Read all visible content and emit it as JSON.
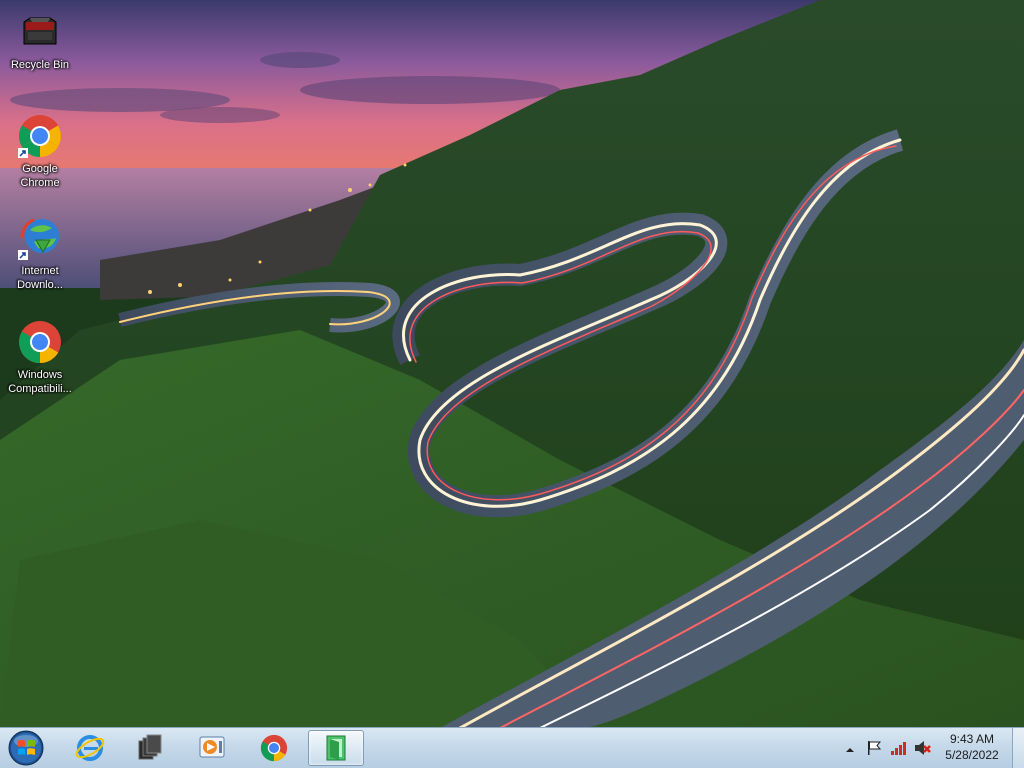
{
  "desktop": {
    "icons": [
      {
        "label": "Recycle Bin",
        "icon": "recycle-bin-icon"
      },
      {
        "label": "Google Chrome",
        "icon": "chrome-icon"
      },
      {
        "label": "Internet Downlo...",
        "icon": "internet-download-manager-icon"
      },
      {
        "label": "Windows Compatibili...",
        "icon": "chrome-icon"
      }
    ]
  },
  "taskbar": {
    "start": {
      "icon": "windows-start-orb-icon"
    },
    "pinned": [
      {
        "icon": "internet-explorer-icon"
      },
      {
        "icon": "window-switcher-icon"
      },
      {
        "icon": "media-player-icon"
      },
      {
        "icon": "chrome-icon"
      },
      {
        "icon": "file-explorer-window-icon",
        "active": true
      }
    ],
    "tray": {
      "icons": [
        "show-hidden-icons-chevron",
        "action-center-flag-icon",
        "network-disconnected-icon",
        "volume-muted-icon"
      ],
      "time": "9:43 AM",
      "date": "5/28/2022"
    }
  },
  "colors": {
    "taskbar_top": "#dbe8f3",
    "taskbar_bottom": "#b6cde2",
    "chrome_red": "#db4437",
    "chrome_green": "#0f9d58",
    "chrome_yellow": "#f4b400",
    "chrome_blue": "#4285f4"
  }
}
